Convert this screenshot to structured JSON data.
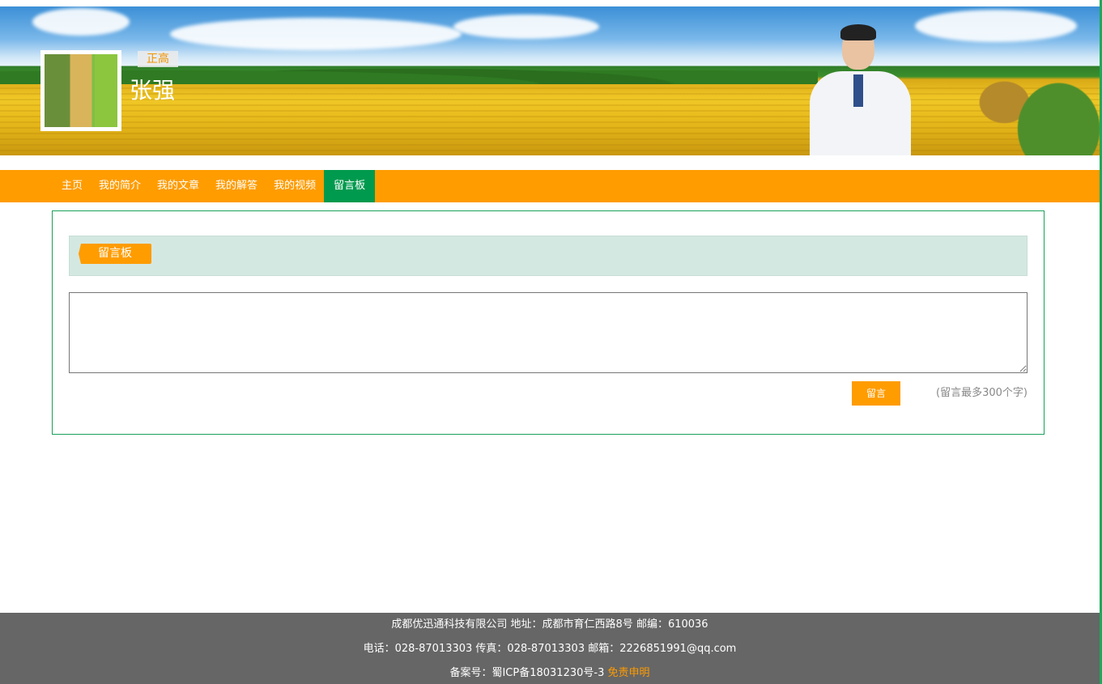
{
  "header": {
    "doctor_title": "正高",
    "doctor_name": "张强"
  },
  "nav": {
    "items": [
      {
        "label": "主页"
      },
      {
        "label": "我的简介"
      },
      {
        "label": "我的文章"
      },
      {
        "label": "我的解答"
      },
      {
        "label": "我的视频"
      },
      {
        "label": "留言板"
      }
    ],
    "active_index": 5
  },
  "board": {
    "tab_label": "留言板",
    "textarea_value": "",
    "submit_label": "留言",
    "hint": "(留言最多300个字)"
  },
  "footer": {
    "line1": "成都优迅通科技有限公司 地址：成都市育仁西路8号 邮编：610036",
    "line2": "电话：028-87013303 传真：028-87013303 邮箱：2226851991@qq.com",
    "line3_prefix": "备案号：蜀ICP备18031230号-3",
    "disclaimer_link": "免责申明"
  },
  "colors": {
    "nav_bg": "#ff9c00",
    "nav_active": "#009a4e",
    "panel_border": "#19a05a",
    "footer_bg": "#666666"
  }
}
